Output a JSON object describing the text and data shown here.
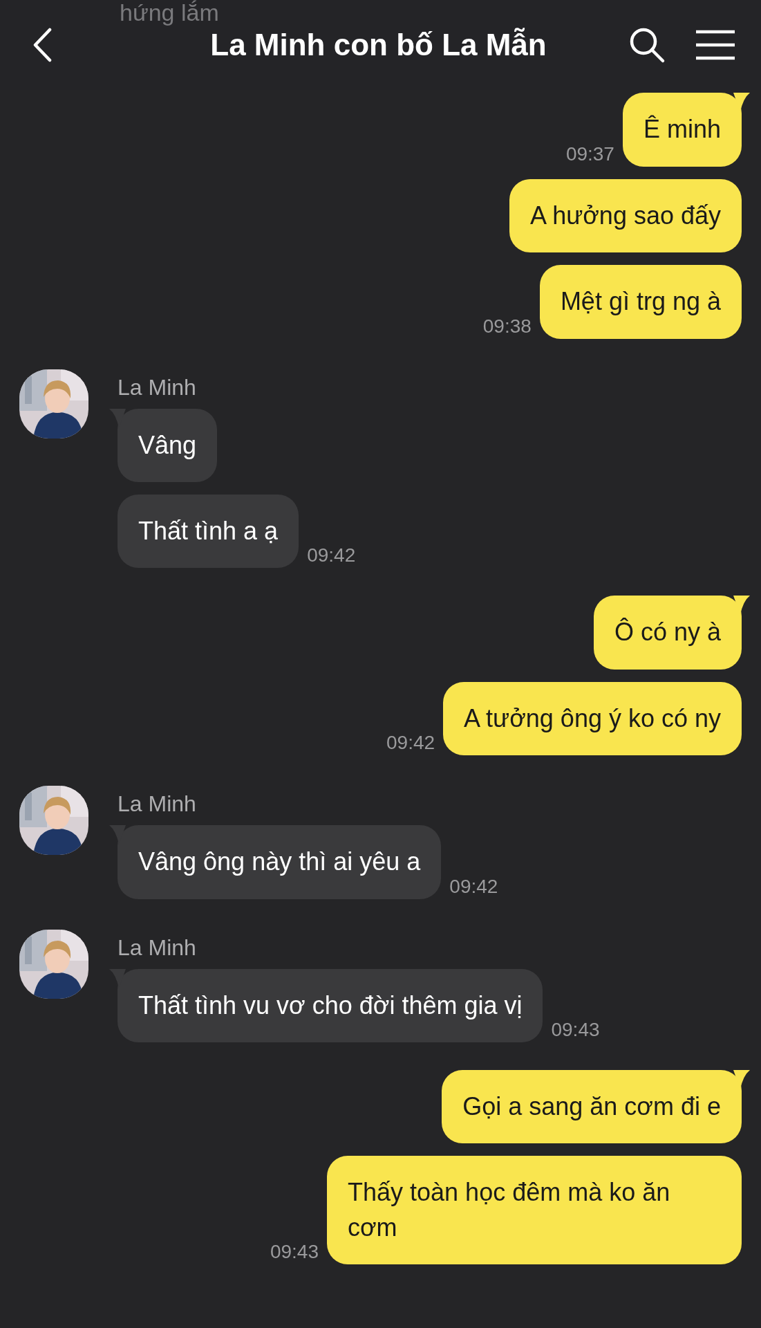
{
  "header": {
    "title": "La Minh con bố La Mẫn"
  },
  "faded_message": {
    "text": "hứng lắm"
  },
  "groups": [
    {
      "kind": "sent",
      "messages": [
        {
          "text": "Ê minh",
          "time": "09:37"
        },
        {
          "text": "A hưởng sao đấy"
        },
        {
          "text": "Mệt gì trg ng à",
          "time": "09:38"
        }
      ]
    },
    {
      "kind": "received",
      "sender": "La Minh",
      "messages": [
        {
          "text": "Vâng"
        },
        {
          "text": "Thất tình a ạ",
          "time": "09:42"
        }
      ]
    },
    {
      "kind": "sent",
      "messages": [
        {
          "text": "Ô có ny à"
        },
        {
          "text": "A tưởng ông ý ko có ny",
          "time": "09:42"
        }
      ]
    },
    {
      "kind": "received",
      "sender": "La Minh",
      "messages": [
        {
          "text": "Vâng ông này thì ai yêu a",
          "time": "09:42"
        }
      ]
    },
    {
      "kind": "received",
      "sender": "La Minh",
      "messages": [
        {
          "text": "Thất tình vu vơ cho đời thêm gia vị",
          "time": "09:43"
        }
      ]
    },
    {
      "kind": "sent",
      "messages": [
        {
          "text": "Gọi a sang ăn cơm đi e"
        },
        {
          "text": "Thấy toàn học đêm mà ko ăn cơm",
          "time": "09:43"
        }
      ]
    }
  ]
}
